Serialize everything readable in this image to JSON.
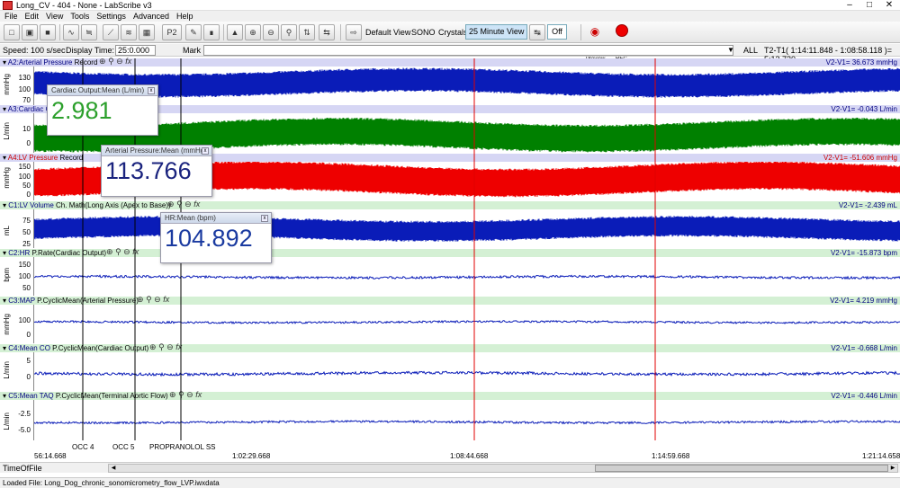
{
  "window": {
    "title": "Long_CV - 404 - None - LabScribe v3"
  },
  "menu": [
    "File",
    "Edit",
    "View",
    "Tools",
    "Settings",
    "Advanced",
    "Help"
  ],
  "toolbar": {
    "default_view": "Default View",
    "sono": "SONO",
    "crystals": "Crystals",
    "minute_view": "25 Minute View",
    "off": "Off",
    "preview": "Preview",
    "rec": "REC",
    "p2_label": "P2"
  },
  "controls": {
    "speed": "Speed: 100 s/sec",
    "display_time_label": "Display Time:",
    "display_time_value": "25:0.000",
    "mark_label": "Mark",
    "all_label": "ALL",
    "t2t1": "T2-T1( 1:14:11.848 - 1:08:58.118 )= 5:13.730"
  },
  "channels": [
    {
      "name": "A2:Arterial Pressure",
      "extra": "Record",
      "v2v1": "V2-V1= 36.673 mmHg",
      "unit": "mmHg",
      "ticks": [
        "130",
        "100",
        "70"
      ],
      "color": "#0a1cb8",
      "hdr_bg": "#d6d6f4",
      "name_color": "#000080"
    },
    {
      "name": "A3:Cardiac O",
      "extra": "",
      "v2v1": "V2-V1= -0.043 L/min",
      "unit": "L/min",
      "ticks": [
        "10",
        "0"
      ],
      "color": "#008000",
      "hdr_bg": "#d6d6f4",
      "name_color": "#000080"
    },
    {
      "name": "A4:LV Pressure",
      "extra": "Record",
      "v2v1": "V2-V1= -51.606 mmHg",
      "unit": "mmHg",
      "ticks": [
        "150",
        "100",
        "50",
        "0"
      ],
      "color": "#ee0000",
      "hdr_bg": "#d6d6f4",
      "name_color": "#cc0000"
    },
    {
      "name": "C1:LV Volume",
      "extra": "Ch. Math(Long Axis (Apex to Base))",
      "v2v1": "V2-V1= -2.439 mL",
      "unit": "mL",
      "ticks": [
        "75",
        "50",
        "25"
      ],
      "color": "#0a1cb8",
      "hdr_bg": "#d4f0d4",
      "name_color": "#000080"
    },
    {
      "name": "C2:HR",
      "extra": "P.Rate(Cardiac Output)",
      "v2v1": "V2-V1= -15.873 bpm",
      "unit": "bpm",
      "ticks": [
        "150",
        "100",
        "50"
      ],
      "color": "#0a1cb8",
      "hdr_bg": "#d4f0d4",
      "name_color": "#000080"
    },
    {
      "name": "C3:MAP",
      "extra": "P.CyclicMean(Arterial Pressure)",
      "v2v1": "V2-V1= 4.219 mmHg",
      "unit": "mmHg",
      "ticks": [
        "100",
        "0"
      ],
      "color": "#0a1cb8",
      "hdr_bg": "#d4f0d4",
      "name_color": "#000080"
    },
    {
      "name": "C4:Mean CO",
      "extra": "P.CyclicMean(Cardiac Output)",
      "v2v1": "V2-V1= -0.668 L/min",
      "unit": "L/min",
      "ticks": [
        "5",
        "0"
      ],
      "color": "#0a1cb8",
      "hdr_bg": "#d4f0d4",
      "name_color": "#000080"
    },
    {
      "name": "C5:Mean TAQ",
      "extra": "P.CyclicMean(Terminal Aortic Flow)",
      "v2v1": "V2-V1= -0.446 L/min",
      "unit": "L/min",
      "ticks": [
        "-2.5",
        "-5.0"
      ],
      "color": "#0a1cb8",
      "hdr_bg": "#d4f0d4",
      "name_color": "#000080"
    }
  ],
  "panels": [
    {
      "title": "Cardiac Output:Mean (L/min)",
      "value": "2.981",
      "color": "#2ca02c"
    },
    {
      "title": "Arterial Pressure:Mean (mmHg)",
      "value": "113.766",
      "color": "#1a237e"
    },
    {
      "title": "HR:Mean (bpm)",
      "value": "104.892",
      "color": "#1a3aa0"
    }
  ],
  "marks": [
    "OCC 4",
    "OCC 5",
    "PROPRANOLOL SS"
  ],
  "time_labels": [
    "56:14.668",
    "1:02:29.668",
    "1:08:44.668",
    "1:14:59.668",
    "1:21:14.658"
  ],
  "time_of_file": "TimeOfFile",
  "status": "Loaded File: Long_Dog_chronic_sonomicrometry_flow_LVP.iwxdata"
}
